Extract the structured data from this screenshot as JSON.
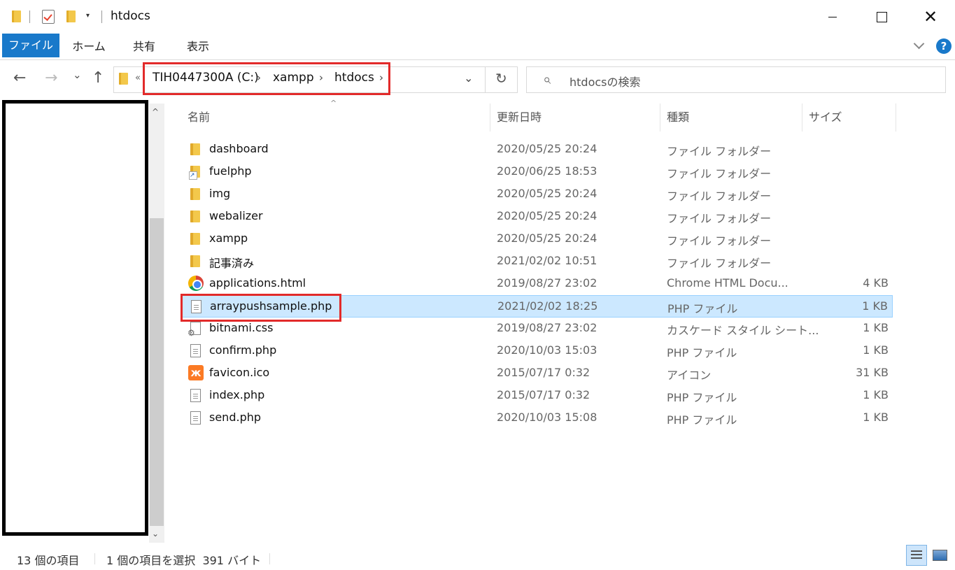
{
  "window": {
    "title": "htdocs",
    "minimize_icon": "minimize-icon",
    "maximize_icon": "maximize-icon",
    "close_glyph": "✕"
  },
  "ribbon": {
    "tabs": [
      {
        "label": "ファイル",
        "active": true
      },
      {
        "label": "ホーム",
        "active": false
      },
      {
        "label": "共有",
        "active": false
      },
      {
        "label": "表示",
        "active": false
      }
    ],
    "help_glyph": "?"
  },
  "navigation": {
    "back_glyph": "←",
    "forward_glyph": "→",
    "recent_glyph": "⌄",
    "up_glyph": "↑",
    "overflow_glyph": "«",
    "breadcrumb": [
      "TIH0447300A (C:)",
      "xampp",
      "htdocs"
    ],
    "crumb_sep": "›",
    "dropdown_glyph": "⌄",
    "refresh_glyph": "↻",
    "search_placeholder": "htdocsの検索",
    "search_glyph": "⌕"
  },
  "file_list": {
    "sort_caret": "^",
    "columns": {
      "name": "名前",
      "date": "更新日時",
      "type": "種類",
      "size": "サイズ"
    },
    "rows": [
      {
        "name": "dashboard",
        "date": "2020/05/25 20:24",
        "type": "ファイル フォルダー",
        "size": "",
        "icon": "folder-icon"
      },
      {
        "name": "fuelphp",
        "date": "2020/06/25 18:53",
        "type": "ファイル フォルダー",
        "size": "",
        "icon": "folder-shortcut-icon"
      },
      {
        "name": "img",
        "date": "2020/05/25 20:24",
        "type": "ファイル フォルダー",
        "size": "",
        "icon": "folder-icon"
      },
      {
        "name": "webalizer",
        "date": "2020/05/25 20:24",
        "type": "ファイル フォルダー",
        "size": "",
        "icon": "folder-icon"
      },
      {
        "name": "xampp",
        "date": "2020/05/25 20:24",
        "type": "ファイル フォルダー",
        "size": "",
        "icon": "folder-icon"
      },
      {
        "name": "記事済み",
        "date": "2021/02/02 10:51",
        "type": "ファイル フォルダー",
        "size": "",
        "icon": "folder-icon"
      },
      {
        "name": "applications.html",
        "date": "2019/08/27 23:02",
        "type": "Chrome HTML Docu...",
        "size": "4 KB",
        "icon": "chrome-icon"
      },
      {
        "name": "arraypushsample.php",
        "date": "2021/02/02 18:25",
        "type": "PHP ファイル",
        "size": "1 KB",
        "icon": "document-icon",
        "selected": true
      },
      {
        "name": "bitnami.css",
        "date": "2019/08/27 23:02",
        "type": "カスケード スタイル シート...",
        "size": "1 KB",
        "icon": "css-icon"
      },
      {
        "name": "confirm.php",
        "date": "2020/10/03 15:03",
        "type": "PHP ファイル",
        "size": "1 KB",
        "icon": "document-icon"
      },
      {
        "name": "favicon.ico",
        "date": "2015/07/17 0:32",
        "type": "アイコン",
        "size": "31 KB",
        "icon": "xampp-icon"
      },
      {
        "name": "index.php",
        "date": "2015/07/17 0:32",
        "type": "PHP ファイル",
        "size": "1 KB",
        "icon": "document-icon"
      },
      {
        "name": "send.php",
        "date": "2020/10/03 15:08",
        "type": "PHP ファイル",
        "size": "1 KB",
        "icon": "document-icon"
      }
    ]
  },
  "scrollbar": {
    "up_glyph": "^",
    "down_glyph": "⌄"
  },
  "status": {
    "item_count": "13 個の項目",
    "selection": "1 個の項目を選択  391 バイト"
  },
  "colors": {
    "accent": "#1979ca",
    "highlight": "#e22a2a",
    "selection": "#cce8ff"
  }
}
